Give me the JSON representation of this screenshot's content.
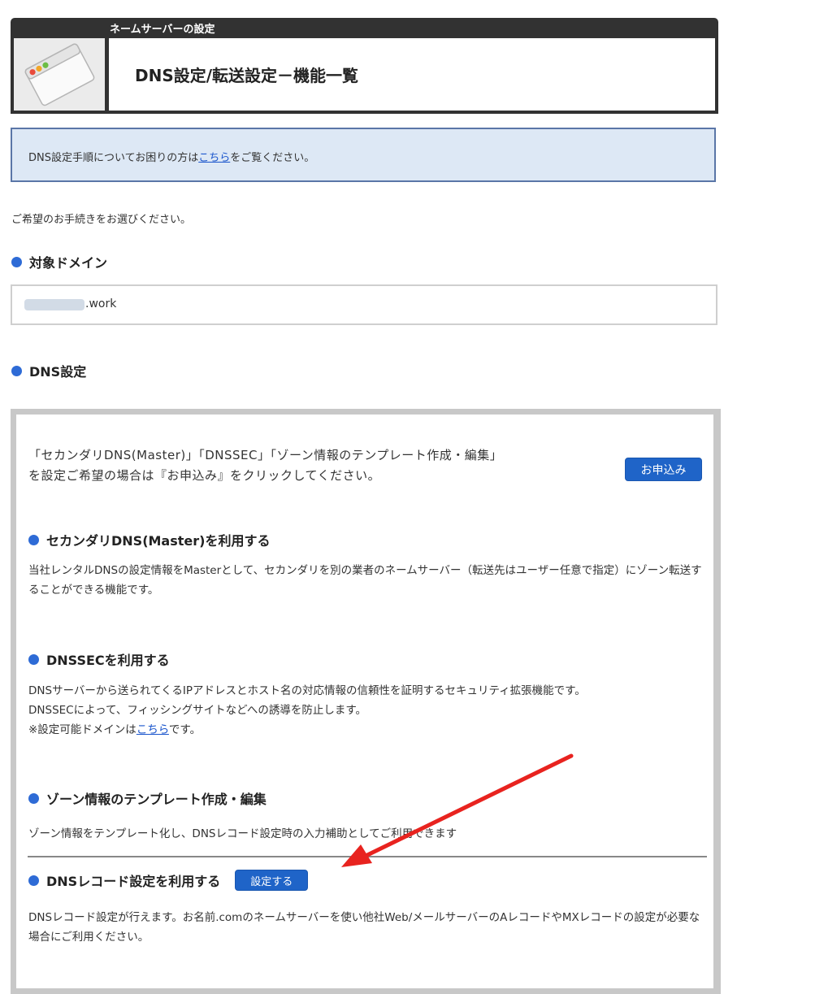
{
  "header": {
    "subtitle": "ネームサーバーの設定",
    "title": "DNS設定/転送設定－機能一覧"
  },
  "notice": {
    "prefix": "DNS設定手順についてお困りの方は",
    "link": "こちら",
    "suffix": "をご覧ください。"
  },
  "instruction": "ご希望のお手続きをお選びください。",
  "target_domain": {
    "heading": "対象ドメイン",
    "domain_suffix": ".work"
  },
  "dns": {
    "heading": "DNS設定",
    "intro": "「セカンダリDNS(Master)」「DNSSEC」「ゾーン情報のテンプレート作成・編集」を設定ご希望の場合は『お申込み』をクリックしてください。",
    "apply_button": "お申込み",
    "features": [
      {
        "title": "セカンダリDNS(Master)を利用する",
        "desc": "当社レンタルDNSの設定情報をMasterとして、セカンダリを別の業者のネームサーバー（転送先はユーザー任意で指定）にゾーン転送することができる機能です。"
      },
      {
        "title": "DNSSECを利用する",
        "desc1": "DNSサーバーから送られてくるIPアドレスとホスト名の対応情報の信頼性を証明するセキュリティ拡張機能です。",
        "desc2": "DNSSECによって、フィッシングサイトなどへの誘導を防止します。",
        "note_prefix": "※設定可能ドメインは",
        "note_link": "こちら",
        "note_suffix": "です。"
      },
      {
        "title": "ゾーン情報のテンプレート作成・編集",
        "desc": "ゾーン情報をテンプレート化し、DNSレコード設定時の入力補助としてご利用できます"
      },
      {
        "title": "DNSレコード設定を利用する",
        "button": "設定する",
        "desc": "DNSレコード設定が行えます。お名前.comのネームサーバーを使い他社Web/メールサーバーのAレコードやMXレコードの設定が必要な場合にご利用ください。"
      }
    ]
  },
  "colors": {
    "header_bg": "#323232",
    "notice_bg": "#dde8f5",
    "notice_border": "#5a76a7",
    "accent_blue": "#1f64c8",
    "bullet_blue": "#2e6bd6",
    "link": "#1a55cc",
    "arrow": "#e8231f"
  },
  "icons": [
    "browser-window-icon",
    "bullet-dot-icon",
    "red-arrow-annotation"
  ]
}
